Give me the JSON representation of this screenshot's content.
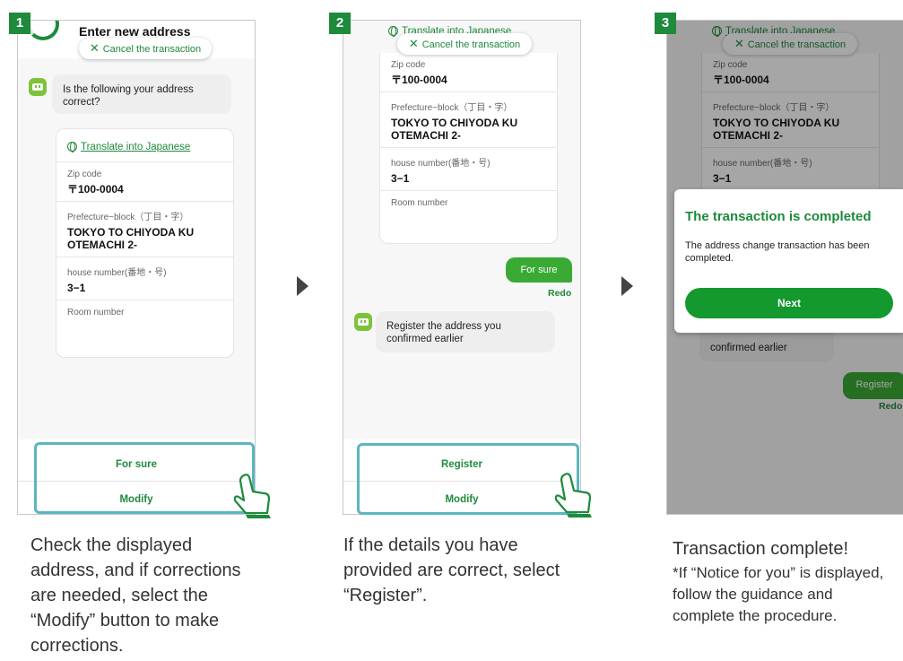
{
  "steps": [
    {
      "number": "1",
      "header": "Enter new address",
      "cancel_label": "Cancel the transaction",
      "bot_message": "Is the following your address correct?",
      "translate_link": "Translate into Japanese",
      "zip_label": "Zip code",
      "zip_value": "〒100-0004",
      "pref_label": "Prefecture~block（丁目・字）",
      "pref_value": "TOKYO TO CHIYODA KU OTEMACHI 2-",
      "house_label": "house number(番地・号)",
      "house_value": "3−1",
      "room_label": "Room number",
      "button_primary": "For sure",
      "button_secondary": "Modify",
      "caption": "Check the displayed address, and if corrections are needed, select the “Modify” button to make corrections."
    },
    {
      "number": "2",
      "translate_link": "Translate into Japanese",
      "cancel_label": "Cancel the transaction",
      "zip_label": "Zip code",
      "zip_value": "〒100-0004",
      "pref_label": "Prefecture~block（丁目・字）",
      "pref_value": "TOKYO TO CHIYODA KU OTEMACHI 2-",
      "house_label": "house number(番地・号)",
      "house_value": "3−1",
      "room_label": "Room number",
      "user_reply": "For sure",
      "redo_label": "Redo",
      "bot_message": "Register the address you confirmed earlier",
      "button_primary": "Register",
      "button_secondary": "Modify",
      "caption": "If the details you have provided are correct, select “Register”."
    },
    {
      "number": "3",
      "translate_link": "Translate into Japanese",
      "cancel_label": "Cancel the transaction",
      "zip_label": "Zip code",
      "zip_value": "〒100-0004",
      "pref_label": "Prefecture~block（丁目・字）",
      "pref_value": "TOKYO TO CHIYODA KU OTEMACHI 2-",
      "house_label": "house number(番地・号)",
      "house_value": "3−1",
      "dialog_title": "The transaction is completed",
      "dialog_text": "The address change transaction has been completed.",
      "dialog_button": "Next",
      "bot_message_tail": "confirmed earlier",
      "user_reply": "Register",
      "redo_label": "Redo",
      "caption": "Transaction complete!",
      "note": "*If “Notice for you” is displayed, follow the guidance and complete the procedure."
    }
  ],
  "colors": {
    "accent": "#1e8a3c",
    "highlight": "#5bb6bf",
    "step_badge": "#1e8a3c"
  }
}
